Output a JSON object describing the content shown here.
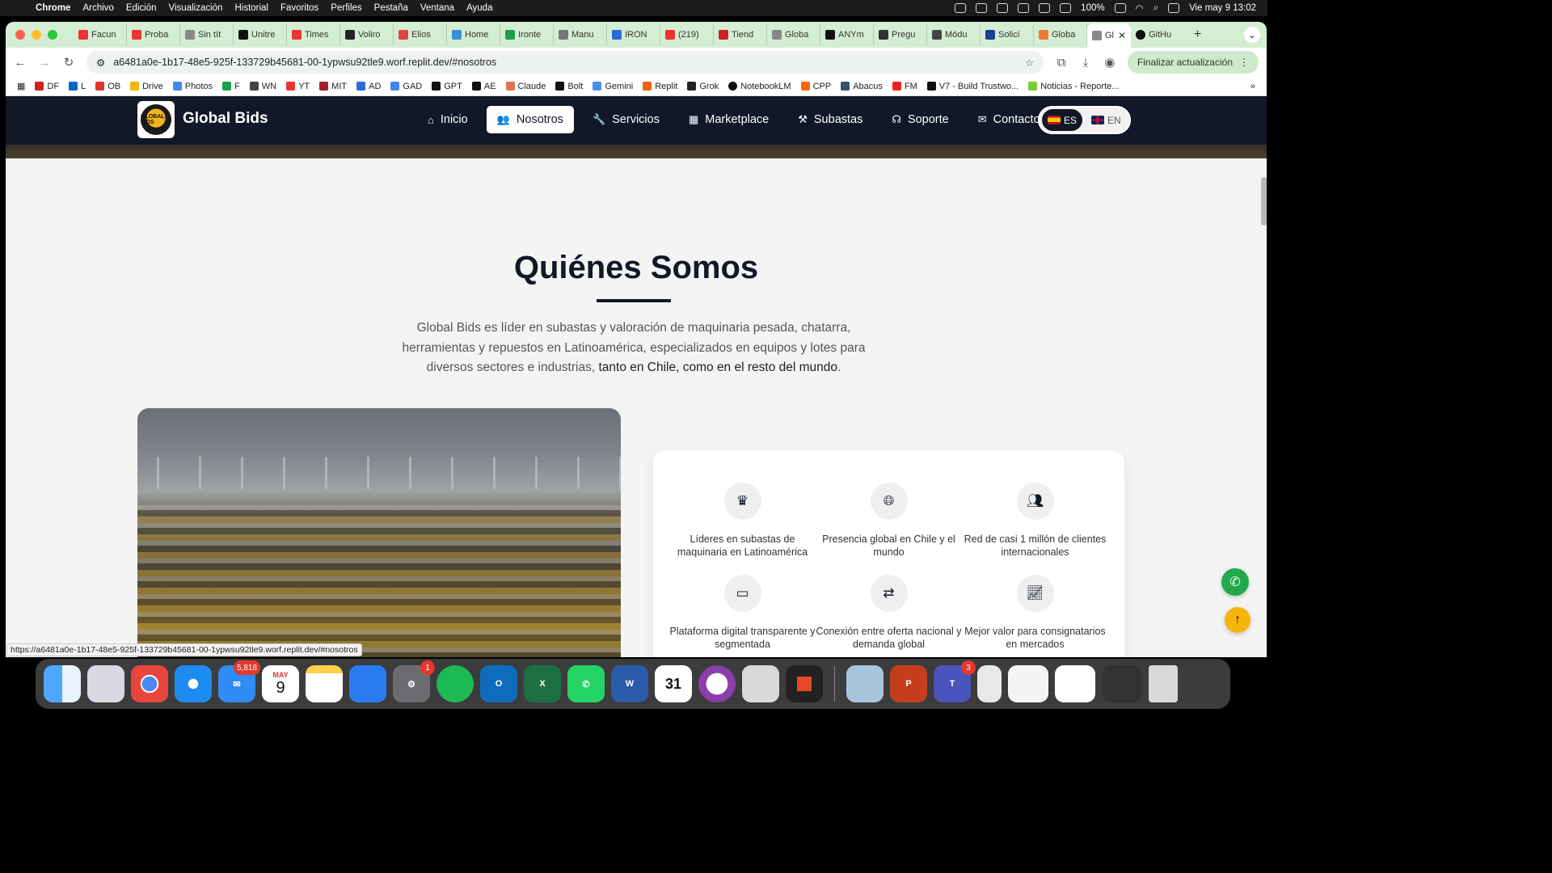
{
  "menubar": {
    "app": "Chrome",
    "items": [
      "Archivo",
      "Edición",
      "Visualización",
      "Historial",
      "Favoritos",
      "Perfiles",
      "Pestaña",
      "Ventana",
      "Ayuda"
    ],
    "battery": "100%",
    "clock": "Vie may 9  13:02"
  },
  "tabs": [
    "Facun",
    "Proba",
    "Sin tít",
    "Unitre",
    "Times",
    "Voliro",
    "Elios",
    "Home",
    "Ironte",
    "Manu",
    "IRON",
    "(219)",
    "Tiend",
    "Globa",
    "ANYm",
    "Pregu",
    "Módu",
    "Solici",
    "Globa"
  ],
  "active_tab": "Gl",
  "last_tab": "GitHu",
  "toolbar": {
    "url": "a6481a0e-1b17-48e5-925f-133729b45681-00-1ypwsu92tle9.worf.replit.dev/#nosotros",
    "update_label": "Finalizar actualización"
  },
  "bookmarks": [
    "DF",
    "L",
    "OB",
    "Drive",
    "Photos",
    "F",
    "WN",
    "YT",
    "MIT",
    "AD",
    "GAD",
    "GPT",
    "AE",
    "Claude",
    "Bolt",
    "Gemini",
    "Replit",
    "Grok",
    "NotebookLM",
    "CPP",
    "Abacus",
    "FM",
    "V7 - Build Trustwo...",
    "Noticias - Reporte..."
  ],
  "site": {
    "brand": "Global Bids",
    "logo_text": "GLOBAL BIDS",
    "nav": [
      {
        "label": "Inicio",
        "icon": "home-icon"
      },
      {
        "label": "Nosotros",
        "icon": "users-icon"
      },
      {
        "label": "Servicios",
        "icon": "wrench-icon"
      },
      {
        "label": "Marketplace",
        "icon": "grid-icon"
      },
      {
        "label": "Subastas",
        "icon": "gavel-icon"
      },
      {
        "label": "Soporte",
        "icon": "headset-icon"
      },
      {
        "label": "Contacto",
        "icon": "envelope-icon"
      }
    ],
    "lang": {
      "es": "ES",
      "en": "EN"
    }
  },
  "section": {
    "title": "Quiénes Somos",
    "desc_main": "Global Bids es líder en subastas y valoración de maquinaria pesada, chatarra, herramientas y repuestos en Latinoamérica, especializados en equipos y lotes para diversos sectores e industrias,",
    "desc_strong": "tanto en Chile, como en el resto del mundo",
    "desc_end": "."
  },
  "features": [
    {
      "icon": "crown-icon",
      "text": "Líderes en subastas de maquinaria en Latinoamérica"
    },
    {
      "icon": "globe-icon",
      "text": "Presencia global en Chile y el mundo"
    },
    {
      "icon": "users-icon",
      "text": "Red de casi 1 millón de clientes internacionales"
    },
    {
      "icon": "laptop-icon",
      "text": "Plataforma digital transparente y segmentada"
    },
    {
      "icon": "exchange-icon",
      "text": "Conexión entre oferta nacional y demanda global"
    },
    {
      "icon": "chart-line-icon",
      "text": "Mejor valor para consignatarios en mercados"
    }
  ],
  "status_url": "https://a6481a0e-1b17-48e5-925f-133729b45681-00-1ypwsu92tle9.worf.replit.dev/#nosotros",
  "dock": {
    "mail_badge": "5,818",
    "calendar_month": "MAY",
    "calendar_day": "9",
    "settings_badge": "1",
    "teams_badge": "3",
    "fantastical_day": "31"
  }
}
